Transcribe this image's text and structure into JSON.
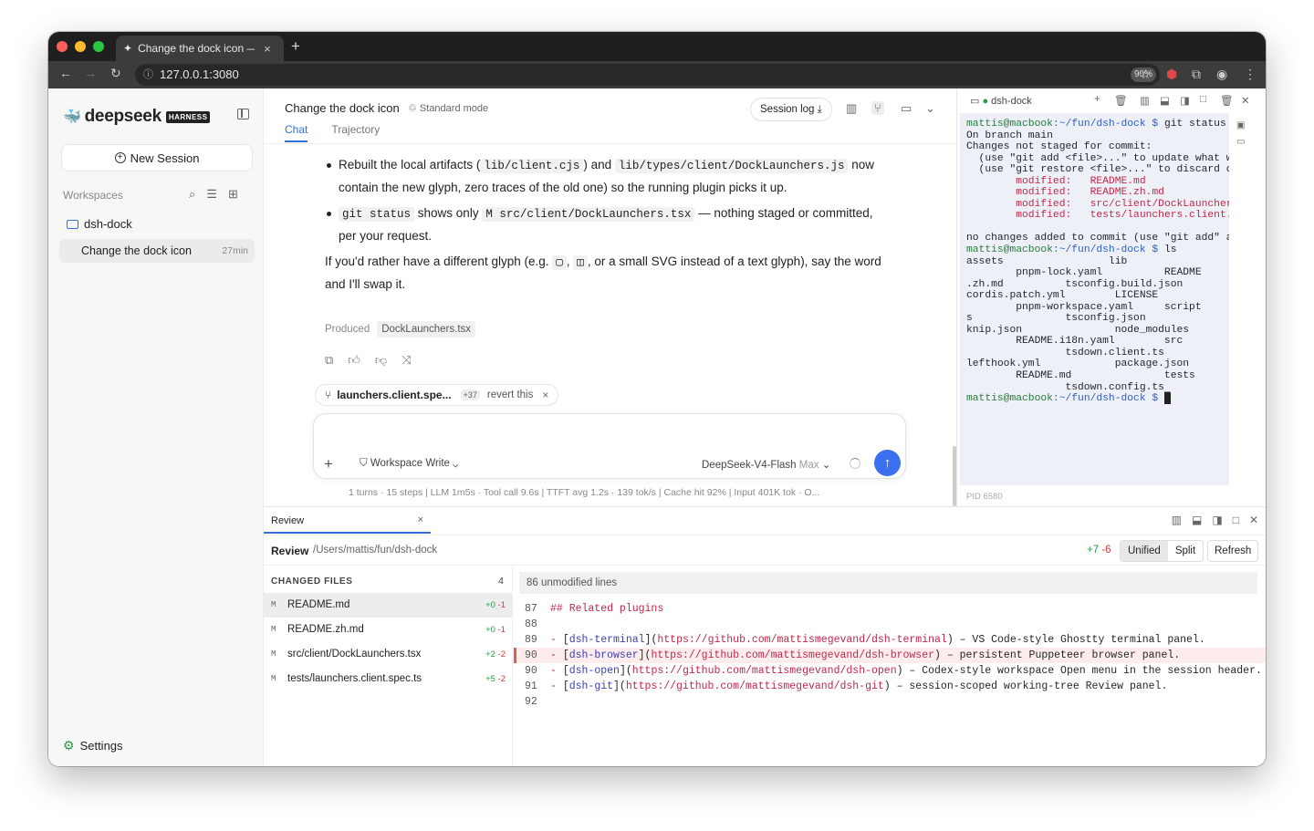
{
  "browser": {
    "tab_title": "Change the dock icon —",
    "tab_close": "×",
    "new_tab": "+",
    "url": "127.0.0.1:3080",
    "zoom": "90%"
  },
  "sidebar": {
    "brand": "deepseek",
    "brand_badge": "HARNESS",
    "new_session": "New Session",
    "workspaces_label": "Workspaces",
    "workspace": "dsh-dock",
    "session": {
      "title": "Change the dock icon",
      "age": "27min"
    },
    "settings": "Settings"
  },
  "header": {
    "title": "Change the dock icon",
    "mode": "Standard mode",
    "tabs": [
      "Chat",
      "Trajectory"
    ],
    "session_log": "Session log"
  },
  "message": {
    "b1_pre": "Rebuilt the local artifacts (",
    "b1_code1": "lib/client.cjs",
    "b1_and": "and",
    "b1_code2": "lib/types/client/DockLaunchers.js",
    "b1_post": "now contain the new glyph, zero traces of the old one) so the running plugin picks it up.",
    "b2_code1": "git status",
    "b2_mid": "shows only",
    "b2_code2": "M src/client/DockLaunchers.tsx",
    "b2_post": "— nothing staged or committed, per your request.",
    "p_pre": "If you'd rather have a different glyph (e.g.",
    "glyph1": "▢",
    "glyph2": "◫",
    "p_post": ", or a small SVG instead of a text glyph), say the word and I'll swap it.",
    "produced_label": "Produced",
    "produced_file": "DockLaunchers.tsx"
  },
  "chip": {
    "file": "launchers.client.spe...",
    "count": "+37",
    "revert": "revert this"
  },
  "composer": {
    "mode": "Workspace Write",
    "model": "DeepSeek-V4-Flash",
    "model_level": "Max"
  },
  "stats": "1 turns · 15 steps  |  LLM 1m5s · Tool call 9.6s  |  TTFT avg 1.2s · 139 tok/s  |  Cache hit 92%  |  Input 401K tok · O...",
  "terminal": {
    "title": "dsh-dock",
    "prompt_user": "mattis@macbook",
    "prompt_path": ":~/fun/dsh-dock $ ",
    "cmd1": "git status",
    "out1": "On branch main\nChanges not staged for commit:\n  (use \"git add <file>...\" to update what will be committed)\n  (use \"git restore <file>...\" to discard changes in working directory)",
    "modified": [
      "README.md",
      "README.zh.md",
      "src/client/DockLaunchers.tsx",
      "tests/launchers.client.spec.ts"
    ],
    "modified_label": "modified:",
    "out2": "no changes added to commit (use \"git add\" and/or \"git commit -a\")",
    "cmd2": "ls",
    "ls_out": "assets                 lib\n        pnpm-lock.yaml          README\n.zh.md          tsconfig.build.json\ncordis.patch.yml        LICENSE\n        pnpm-workspace.yaml     script\ns               tsconfig.json\nknip.json               node_modules\n        README.i18n.yaml        src\n                tsdown.client.ts\nlefthook.yml            package.json\n        README.md               tests\n                tsdown.config.ts",
    "pid": "PID 6580"
  },
  "review": {
    "tab": "Review",
    "label": "Review",
    "path": "/Users/mattis/fun/dsh-dock",
    "added": "+7",
    "removed": "-6",
    "views": [
      "Unified",
      "Split"
    ],
    "refresh": "Refresh",
    "changed_files_label": "CHANGED FILES",
    "changed_count": "4",
    "files": [
      {
        "status": "M",
        "name": "README.md",
        "add": "+0",
        "del": "-1"
      },
      {
        "status": "M",
        "name": "README.zh.md",
        "add": "+0",
        "del": "-1"
      },
      {
        "status": "M",
        "name": "src/client/DockLaunchers.tsx",
        "add": "+2",
        "del": "-2"
      },
      {
        "status": "M",
        "name": "tests/launchers.client.spec.ts",
        "add": "+5",
        "del": "-2"
      }
    ],
    "unmodified": "86 unmodified lines",
    "lines": [
      {
        "n": "87",
        "t": "## Related plugins"
      },
      {
        "n": "88",
        "t": ""
      },
      {
        "n": "89",
        "name": "dsh-terminal",
        "url": "https://github.com/mattismegevand/dsh-terminal",
        "desc": " – VS Code-style Ghostty terminal panel."
      },
      {
        "n": "90",
        "name": "dsh-browser",
        "url": "https://github.com/mattismegevand/dsh-browser",
        "desc": " – persistent Puppeteer browser panel."
      },
      {
        "n": "90",
        "name": "dsh-open",
        "url": "https://github.com/mattismegevand/dsh-open",
        "desc": " – Codex-style workspace Open menu in the session header."
      },
      {
        "n": "91",
        "name": "dsh-git",
        "url": "https://github.com/mattismegevand/dsh-git",
        "desc": " – session-scoped working-tree Review panel."
      },
      {
        "n": "92",
        "t": ""
      }
    ]
  },
  "colors": {
    "accent": "#2f6fe0",
    "send": "#3a6ff0",
    "add": "#2a9a48",
    "del": "#d13b3b"
  }
}
